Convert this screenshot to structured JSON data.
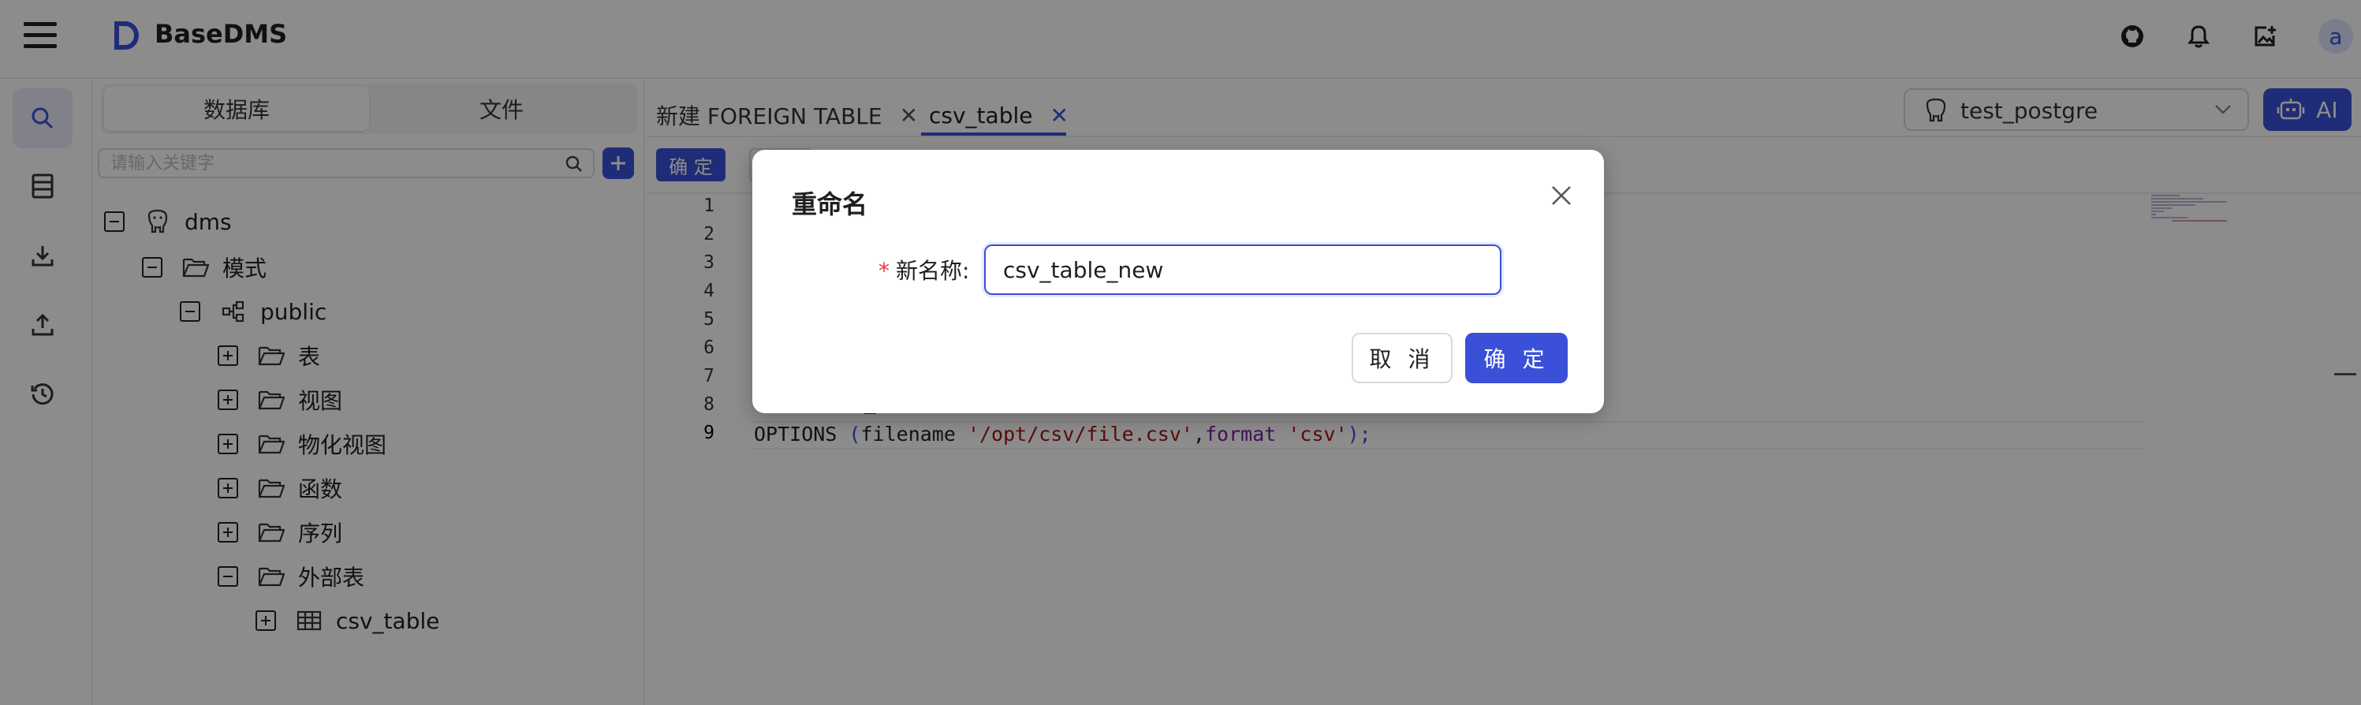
{
  "app": {
    "title": "BaseDMS",
    "avatar_letter": "a",
    "accent_color": "#3a50d9"
  },
  "header": {
    "icons": [
      "github-icon",
      "bell-icon",
      "image-upload-icon"
    ]
  },
  "rail": {
    "items": [
      "search-icon",
      "database-icon",
      "download-icon",
      "upload-icon",
      "history-icon"
    ]
  },
  "panel": {
    "segments": [
      {
        "label": "数据库",
        "active": true
      },
      {
        "label": "文件",
        "active": false
      }
    ],
    "search_placeholder": "请输入关键字"
  },
  "tree": [
    {
      "label": "dms",
      "expanded": true,
      "icon": "postgres-icon"
    },
    {
      "label": "模式",
      "expanded": true,
      "icon": "folder-open-icon"
    },
    {
      "label": "public",
      "expanded": true,
      "icon": "schema-icon"
    },
    {
      "label": "表",
      "expanded": false,
      "icon": "folder-open-icon"
    },
    {
      "label": "视图",
      "expanded": false,
      "icon": "folder-open-icon"
    },
    {
      "label": "物化视图",
      "expanded": false,
      "icon": "folder-open-icon"
    },
    {
      "label": "函数",
      "expanded": false,
      "icon": "folder-open-icon"
    },
    {
      "label": "序列",
      "expanded": false,
      "icon": "folder-open-icon"
    },
    {
      "label": "外部表",
      "expanded": true,
      "icon": "folder-open-icon"
    },
    {
      "label": "csv_table",
      "expanded": false,
      "icon": "table-icon"
    }
  ],
  "tabs": [
    {
      "label": "新建 FOREIGN TABLE",
      "active": false
    },
    {
      "label": "csv_table",
      "active": true
    }
  ],
  "connection": {
    "selected": "test_postgre"
  },
  "ai_button_label": "AI",
  "toolbar": {
    "confirm_label": "确 定"
  },
  "editor": {
    "line_numbers": [
      "1",
      "2",
      "3",
      "4",
      "5",
      "6",
      "7",
      "8",
      "9"
    ],
    "visible_code": {
      "line8_fragment": "_",
      "line9": {
        "kw": "OPTIONS ",
        "open": "(",
        "key1": "filename ",
        "str1": "'/opt/csv/file.csv'",
        "comma": ",",
        "key2": "format ",
        "str2": "'csv'",
        "close": ");"
      }
    }
  },
  "modal": {
    "title": "重命名",
    "field_label": "新名称:",
    "field_value": "csv_table_new",
    "cancel_label": "取 消",
    "ok_label": "确 定"
  }
}
